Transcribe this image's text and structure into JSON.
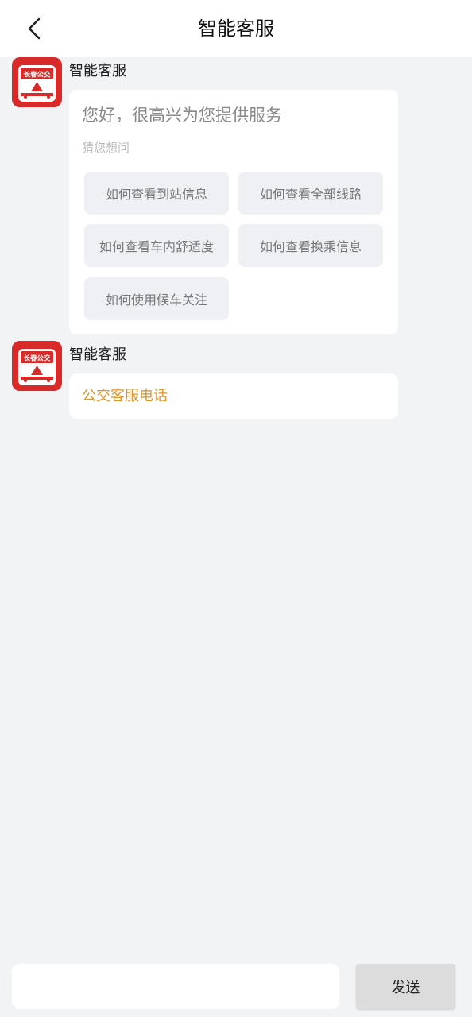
{
  "header": {
    "title": "智能客服",
    "back_icon": "chevron-left-icon"
  },
  "messages": [
    {
      "sender": "智能客服",
      "avatar_text": "长春公交",
      "greeting": "您好，很高兴为您提供服务",
      "hint": "猜您想问",
      "questions": [
        "如何查看到站信息",
        "如何查看全部线路",
        "如何查看车内舒适度",
        "如何查看换乘信息",
        "如何使用候车关注"
      ]
    },
    {
      "sender": "智能客服",
      "avatar_text": "长春公交",
      "link_text": "公交客服电话"
    }
  ],
  "footer": {
    "input_value": "",
    "send_label": "发送"
  },
  "colors": {
    "brand_red": "#d92a2a",
    "link_orange": "#e0962a",
    "background": "#f2f3f5"
  }
}
